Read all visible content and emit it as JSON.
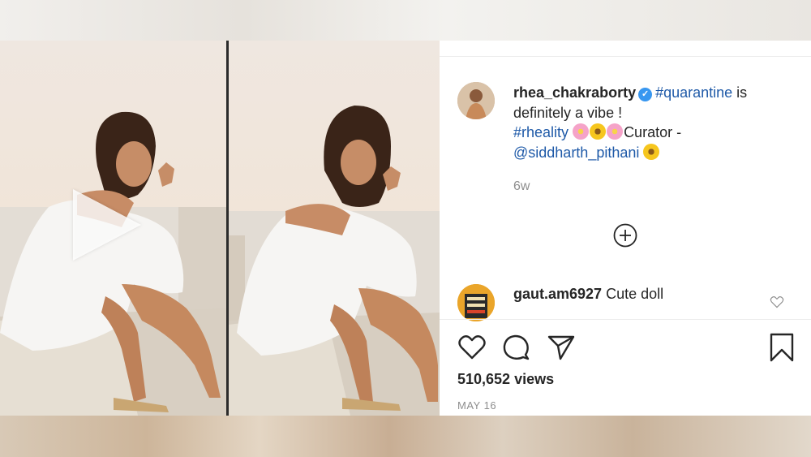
{
  "post": {
    "username": "rhea_chakraborty",
    "verified_icon": "verified-badge-icon",
    "caption_tag_1": "#quarantine",
    "caption_text_1": " is definitely a vibe !",
    "caption_tag_2": "#rheality",
    "caption_text_2": "Curator -",
    "caption_mention": "@siddharth_pithani",
    "time_ago": "6w",
    "views": "510,652 views",
    "date": "MAY 16"
  },
  "comments": [
    {
      "username": "gaut.am6927",
      "text": "Cute doll"
    }
  ],
  "icons": {
    "play": "play-icon",
    "load_more": "plus-circle-icon",
    "like": "heart-icon",
    "comment": "speech-bubble-icon",
    "share": "paper-plane-icon",
    "save": "bookmark-icon"
  },
  "colors": {
    "verified": "#3897f0",
    "hashtag": "#00376b",
    "muted": "#8e8e8e",
    "text": "#262626"
  }
}
